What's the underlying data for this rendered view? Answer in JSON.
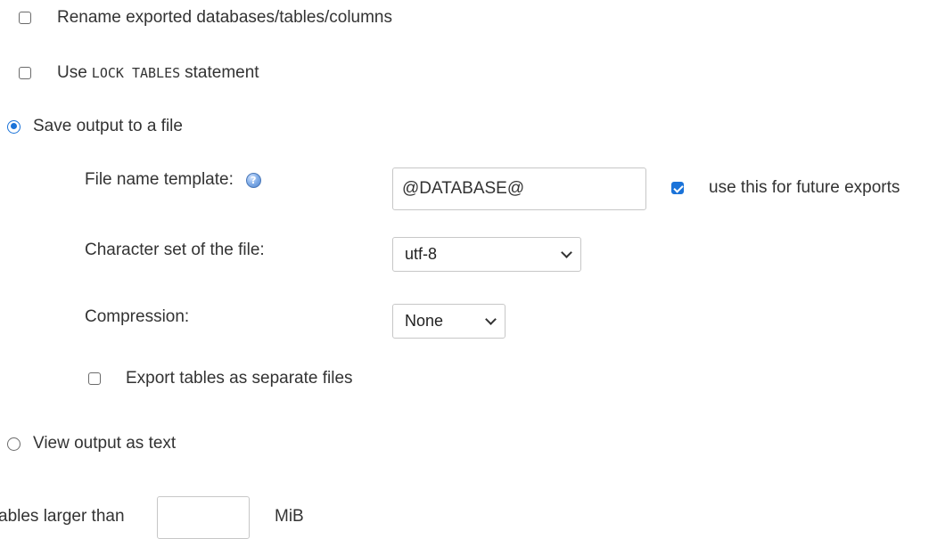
{
  "options": {
    "rename_label": "Rename exported databases/tables/columns",
    "lock_tables": {
      "prefix": "Use",
      "code": "LOCK TABLES",
      "suffix": "statement"
    }
  },
  "output": {
    "save_to_file_label": "Save output to a file",
    "view_as_text_label": "View output as text",
    "selected": "save_to_file"
  },
  "file_settings": {
    "file_name_template_label": "File name template:",
    "file_name_template_value": "@DATABASE@",
    "use_for_future_label": "use this for future exports",
    "use_for_future_checked": true,
    "charset_label": "Character set of the file:",
    "charset_value": "utf-8",
    "compression_label": "Compression:",
    "compression_value": "None",
    "separate_files_label": "Export tables as separate files"
  },
  "skip_tables": {
    "label_visible": "ables larger than",
    "size_value": "",
    "unit": "MiB"
  },
  "icons": {
    "help": "help-icon",
    "checkmark": "check-icon",
    "dropdown": "chevron-down-icon"
  },
  "colors": {
    "accent": "#1a73d9",
    "text": "#333333",
    "border": "#c7c7c7"
  }
}
